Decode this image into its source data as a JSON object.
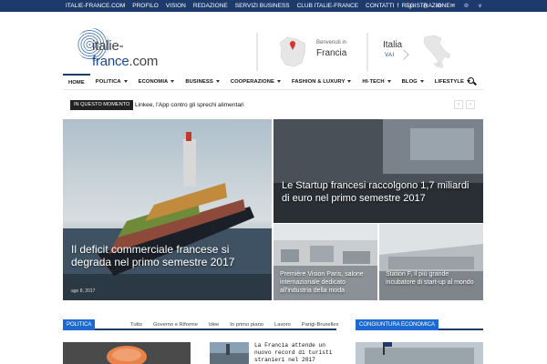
{
  "topbar": {
    "links": [
      "ITALIE-FRANCE.COM",
      "PROFILO",
      "VISION",
      "REDAZIONE",
      "SERVIZI BUSINESS",
      "CLUB ITALIE-FRANCE",
      "CONTATTI",
      "REGISTRAZIONE"
    ],
    "social_icons": [
      "facebook-icon",
      "google-plus-icon",
      "instagram-icon",
      "linkedin-icon",
      "email-icon",
      "pinterest-icon",
      "vimeo-icon"
    ],
    "social_glyphs": [
      "f",
      "g+",
      "◎",
      "in",
      "✉",
      "℗",
      "v"
    ]
  },
  "logo": {
    "pre": "italie-",
    "brand": "france",
    "post": ".com"
  },
  "header_boxes": {
    "francia": {
      "small": "Benvenuti in",
      "big": "Francia"
    },
    "italia": {
      "big": "Italia",
      "vai": "VAI"
    }
  },
  "nav": {
    "items": [
      {
        "label": "HOME",
        "caret": false
      },
      {
        "label": "POLITICA",
        "caret": true
      },
      {
        "label": "ECONOMIA",
        "caret": true
      },
      {
        "label": "BUSINESS",
        "caret": true
      },
      {
        "label": "COOPERAZIONE",
        "caret": true
      },
      {
        "label": "FASHION & LUXURY",
        "caret": true
      },
      {
        "label": "HI-TECH",
        "caret": true
      },
      {
        "label": "BLOG",
        "caret": true
      },
      {
        "label": "LIFESTYLE",
        "caret": true
      }
    ]
  },
  "ticker": {
    "tag": "IN QUESTO MOMENTO",
    "headline": "Linkee, l'App contro gli sprechi alimentari",
    "prev": "‹",
    "next": "›"
  },
  "featured": {
    "main": {
      "title": "Il deficit commerciale francese si degrada nel primo semestre 2017",
      "date": "ago 8, 2017"
    },
    "top_right": {
      "title": "Le Startup francesi raccolgono 1,7 miliardi di euro nel primo semestre 2017"
    },
    "bottom_left": {
      "title": "Première Vision Paris, salone internazionale dedicato all'industria della moda"
    },
    "bottom_right": {
      "title": "Station F, il più grande incubatore di start-up al mondo"
    }
  },
  "sections": {
    "politica": {
      "label": "POLITICA",
      "tabs": [
        "Tutto",
        "Governo e Riforme",
        "Idee",
        "In primo piano",
        "Lavoro",
        "Parigi-Bruxelles"
      ]
    },
    "congiuntura": {
      "label": "CONGIUNTURA ECONOMICA"
    }
  },
  "mini_article": {
    "title": "La Francia attende un nuovo record di turisti stranieri nel 2017"
  },
  "colors": {
    "brand": "#1c3a6b",
    "accent": "#1c6ad1"
  }
}
